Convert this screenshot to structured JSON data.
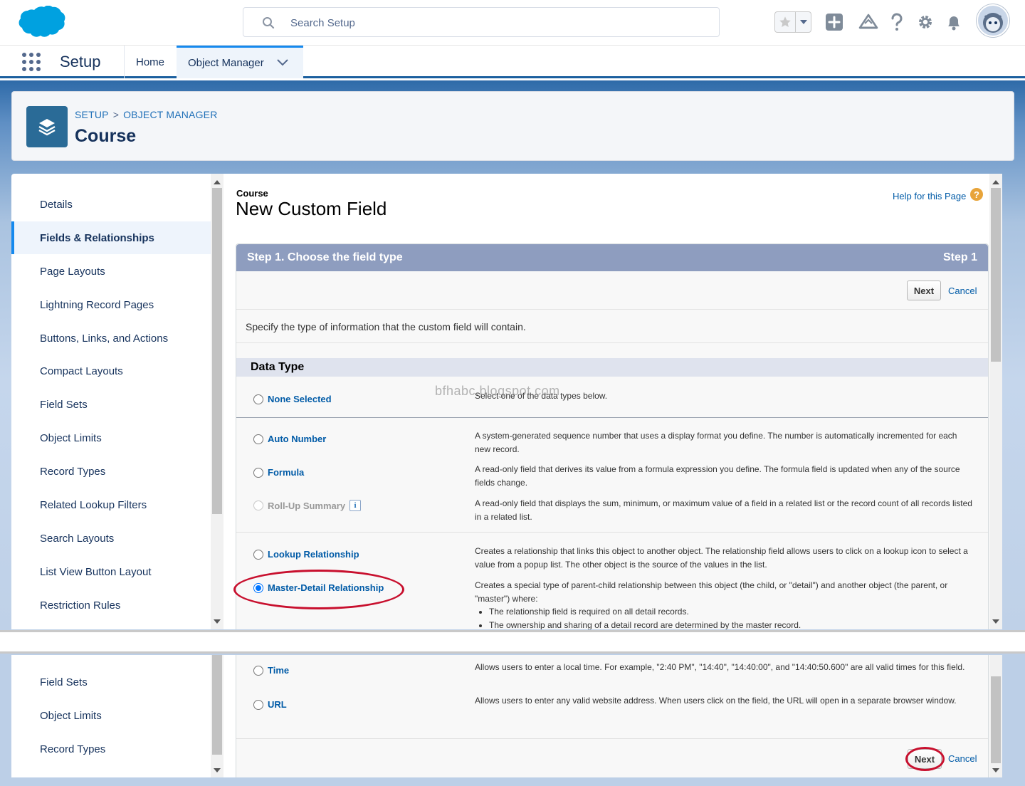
{
  "header": {
    "search_placeholder": "Search Setup",
    "icons": [
      "salesforce-cloud-logo",
      "search-icon",
      "star-icon",
      "chevron-down-icon",
      "plus-icon",
      "trailhead-icon",
      "help-icon",
      "gear-icon",
      "bell-icon",
      "avatar"
    ]
  },
  "nav": {
    "app_name": "Setup",
    "tabs": [
      {
        "label": "Home"
      },
      {
        "label": "Object Manager",
        "active": true
      }
    ]
  },
  "object_header": {
    "breadcrumb": [
      "SETUP",
      ">",
      "OBJECT MANAGER"
    ],
    "title": "Course"
  },
  "sidebar": {
    "items": [
      {
        "label": "Details"
      },
      {
        "label": "Fields & Relationships",
        "active": true
      },
      {
        "label": "Page Layouts"
      },
      {
        "label": "Lightning Record Pages"
      },
      {
        "label": "Buttons, Links, and Actions"
      },
      {
        "label": "Compact Layouts"
      },
      {
        "label": "Field Sets"
      },
      {
        "label": "Object Limits"
      },
      {
        "label": "Record Types"
      },
      {
        "label": "Related Lookup Filters"
      },
      {
        "label": "Search Layouts"
      },
      {
        "label": "List View Button Layout"
      },
      {
        "label": "Restriction Rules"
      }
    ],
    "items_lower": [
      {
        "label": "Field Sets"
      },
      {
        "label": "Object Limits"
      },
      {
        "label": "Record Types"
      }
    ]
  },
  "main": {
    "kicker": "Course",
    "title": "New Custom Field",
    "help_link": "Help for this Page",
    "help_icon": "?",
    "step_title": "Step 1. Choose the field type",
    "step_label": "Step 1",
    "next_label": "Next",
    "cancel_label": "Cancel",
    "instruction": "Specify the type of information that the custom field will contain.",
    "data_type_heading": "Data Type",
    "watermark": "bfhabc.blogspot.com",
    "options": [
      {
        "label": "None Selected",
        "desc": "Select one of the data types below.",
        "checked": false
      },
      {
        "label": "Auto Number",
        "desc": "A system-generated sequence number that uses a display format you define. The number is automatically incremented for each new record.",
        "checked": false
      },
      {
        "label": "Formula",
        "desc": "A read-only field that derives its value from a formula expression you define. The formula field is updated when any of the source fields change.",
        "checked": false
      },
      {
        "label": "Roll-Up Summary",
        "desc": "A read-only field that displays the sum, minimum, or maximum value of a field in a related list or the record count of all records listed in a related list.",
        "checked": false,
        "disabled": true,
        "info": "i"
      },
      {
        "label": "Lookup Relationship",
        "desc": "Creates a relationship that links this object to another object. The relationship field allows users to click on a lookup icon to select a value from a popup list. The other object is the source of the values in the list.",
        "checked": false
      },
      {
        "label": "Master-Detail Relationship",
        "desc": "Creates a special type of parent-child relationship between this object (the child, or \"detail\") and another object (the parent, or \"master\") where:",
        "checked": true,
        "bullets": [
          "The relationship field is required on all detail records.",
          "The ownership and sharing of a detail record are determined by the master record."
        ]
      }
    ],
    "options_lower": [
      {
        "label": "Time",
        "desc": "Allows users to enter a local time. For example, \"2:40 PM\", \"14:40\", \"14:40:00\", and \"14:40:50.600\" are all valid times for this field.",
        "checked": false
      },
      {
        "label": "URL",
        "desc": "Allows users to enter any valid website address. When users click on the field, the URL will open in a separate browser window.",
        "checked": false
      }
    ]
  },
  "colors": {
    "brand_blue": "#00a1e0",
    "step_header": "#8e9dbf",
    "link": "#015ba7",
    "highlight_oval": "#c8102e"
  }
}
